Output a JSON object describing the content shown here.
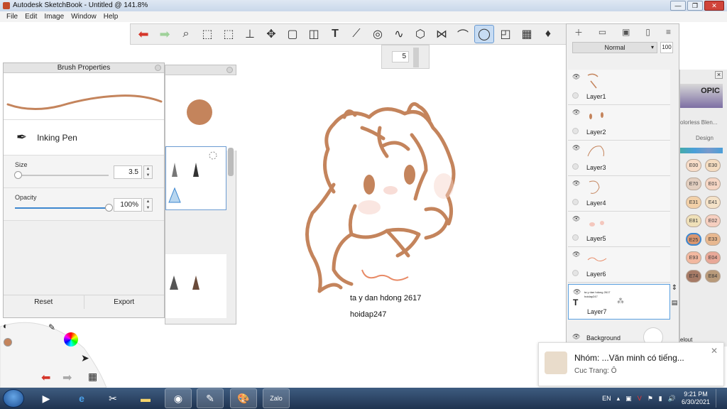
{
  "window": {
    "title": "Autodesk SketchBook - Untitled @ 141.8%",
    "min_label": "—",
    "max_label": "❐",
    "close_label": "✕"
  },
  "menu": [
    "File",
    "Edit",
    "Image",
    "Window",
    "Help"
  ],
  "toolbar": {
    "brush_size": "5"
  },
  "brush_properties": {
    "title": "Brush Properties",
    "brush_name": "Inking Pen",
    "size_label": "Size",
    "size_value": "3.5",
    "size_fraction": 0.03,
    "opacity_label": "Opacity",
    "opacity_value": "100%",
    "opacity_fraction": 1.0,
    "reset_label": "Reset",
    "export_label": "Export"
  },
  "colors": {
    "brush": "#c4845c",
    "accent": "#3d87cf",
    "selection": "#5aa0e0"
  },
  "layers": {
    "blend_mode": "Normal",
    "opacity": "100",
    "items": [
      {
        "name": "Layer1"
      },
      {
        "name": "Layer2"
      },
      {
        "name": "Layer3"
      },
      {
        "name": "Layer4"
      },
      {
        "name": "Layer5"
      },
      {
        "name": "Layer6"
      },
      {
        "name": "Layer7",
        "thumb_text": "ta y dan hdong 2617 hoidap247"
      }
    ],
    "background_label": "Background"
  },
  "copic": {
    "logo": "OPIC",
    "colorless": "olorless Blen...",
    "design_tab": "Design",
    "bottom_label": "elout",
    "swatches": [
      [
        "E00",
        "E30"
      ],
      [
        "E70",
        "E01"
      ],
      [
        "E31",
        "E41"
      ],
      [
        "E81",
        "E02"
      ],
      [
        "E25",
        "E33"
      ],
      [
        "E93",
        "E04"
      ],
      [
        "E74",
        "E84"
      ]
    ]
  },
  "canvas_text": {
    "line1": "ta y dan hdong 2617",
    "line2": "hoidap247"
  },
  "notification": {
    "title": "Nhóm: ...Văn minh có tiếng...",
    "message": "Cuc Trang: Ô"
  },
  "taskbar": {
    "language": "EN",
    "time": "9:21 PM",
    "date": "6/30/2021",
    "zalo_label": "Zalo"
  }
}
